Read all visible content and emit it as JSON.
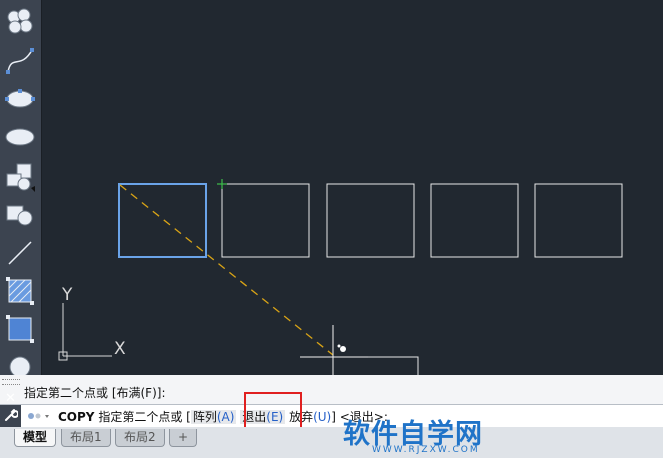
{
  "toolbar": {
    "tools": [
      "revision-cloud-icon",
      "spline-icon",
      "ellipse-icon",
      "ellipse-arc-icon",
      "insert-block-icon",
      "make-block-icon",
      "line-icon",
      "hatch-icon",
      "gradient-icon",
      "region-icon"
    ]
  },
  "canvas": {
    "ucs_y_label": "Y",
    "ucs_x_label": "X"
  },
  "command": {
    "history": "指定第二个点或 [布满(F)]:",
    "current_command": "COPY",
    "prompt": "指定第二个点或",
    "bracket_open": "[",
    "option_array_label": "阵列",
    "option_array_key": "(A)",
    "option_exit_label": "退出",
    "option_exit_key": "(E)",
    "option_undo_label": "放弃",
    "option_undo_key": "(U)",
    "trailing": "] <退出>:",
    "close_label": "✕"
  },
  "layout_tabs": [
    {
      "label": "模型",
      "active": true
    },
    {
      "label": "布局1",
      "active": false
    },
    {
      "label": "布局2",
      "active": false
    },
    {
      "label": "+",
      "active": false
    }
  ],
  "watermark": {
    "title": "软件自学网",
    "url": "WWW.RJZXW.COM"
  },
  "colors": {
    "canvas_bg": "#212830",
    "selected_square": "#6aa3e8",
    "copy_path": "#d9a416",
    "highlight": "#e02020"
  }
}
